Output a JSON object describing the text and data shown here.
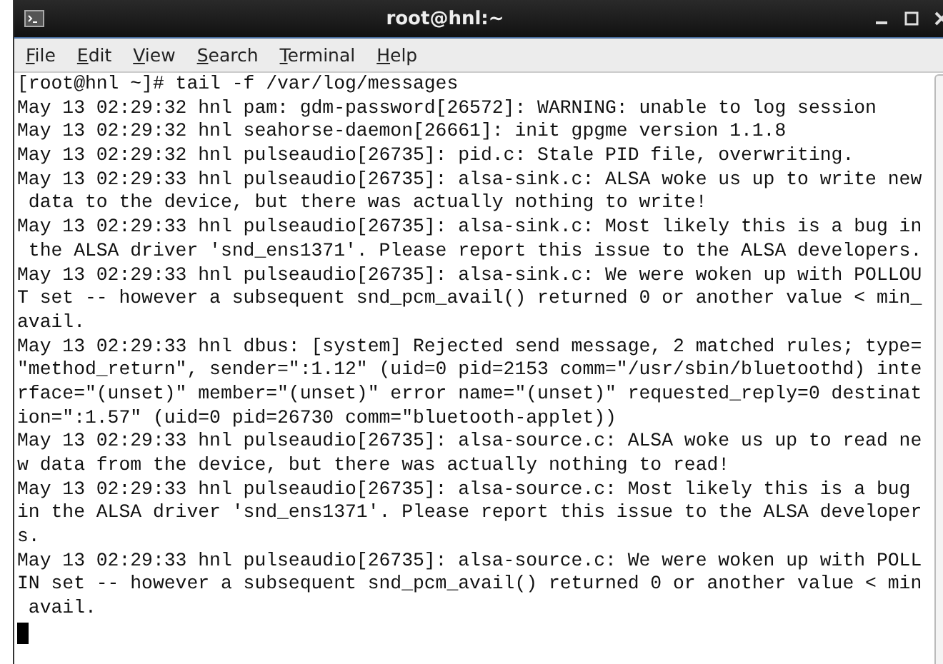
{
  "window": {
    "title": "root@hnl:~"
  },
  "menu": [
    "File",
    "Edit",
    "View",
    "Search",
    "Terminal",
    "Help"
  ],
  "terminal": {
    "lines": [
      "[root@hnl ~]# tail -f /var/log/messages",
      "May 13 02:29:32 hnl pam: gdm-password[26572]: WARNING: unable to log session",
      "May 13 02:29:32 hnl seahorse-daemon[26661]: init gpgme version 1.1.8",
      "May 13 02:29:32 hnl pulseaudio[26735]: pid.c: Stale PID file, overwriting.",
      "May 13 02:29:33 hnl pulseaudio[26735]: alsa-sink.c: ALSA woke us up to write new",
      " data to the device, but there was actually nothing to write!",
      "May 13 02:29:33 hnl pulseaudio[26735]: alsa-sink.c: Most likely this is a bug in",
      " the ALSA driver 'snd_ens1371'. Please report this issue to the ALSA developers.",
      "May 13 02:29:33 hnl pulseaudio[26735]: alsa-sink.c: We were woken up with POLLOU",
      "T set -- however a subsequent snd_pcm_avail() returned 0 or another value < min_",
      "avail.",
      "May 13 02:29:33 hnl dbus: [system] Rejected send message, 2 matched rules; type=",
      "\"method_return\", sender=\":1.12\" (uid=0 pid=2153 comm=\"/usr/sbin/bluetoothd) inte",
      "rface=\"(unset)\" member=\"(unset)\" error name=\"(unset)\" requested_reply=0 destinat",
      "ion=\":1.57\" (uid=0 pid=26730 comm=\"bluetooth-applet))",
      "May 13 02:29:33 hnl pulseaudio[26735]: alsa-source.c: ALSA woke us up to read ne",
      "w data from the device, but there was actually nothing to read!",
      "May 13 02:29:33 hnl pulseaudio[26735]: alsa-source.c: Most likely this is a bug ",
      "in the ALSA driver 'snd_ens1371'. Please report this issue to the ALSA developer",
      "s.",
      "May 13 02:29:33 hnl pulseaudio[26735]: alsa-source.c: We were woken up with POLL",
      "IN set -- however a subsequent snd_pcm_avail() returned 0 or another value < min",
      " avail."
    ]
  }
}
